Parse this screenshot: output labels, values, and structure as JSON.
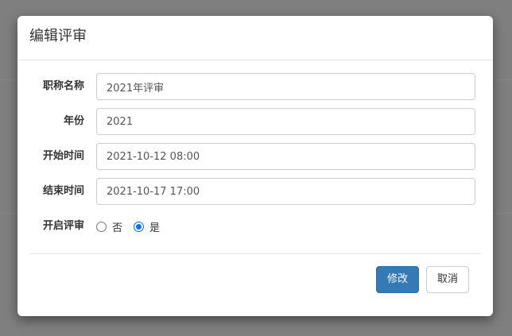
{
  "modal": {
    "title": "编辑评审",
    "fields": [
      {
        "label": "职称名称",
        "value": "2021年评审"
      },
      {
        "label": "年份",
        "value": "2021"
      },
      {
        "label": "开始时间",
        "value": "2021-10-12 08:00"
      },
      {
        "label": "结束时间",
        "value": "2021-10-17 17:00"
      }
    ],
    "radio": {
      "label": "开启评审",
      "options": [
        "否",
        "是"
      ],
      "selected": "是"
    },
    "buttons": {
      "submit": "修改",
      "cancel": "取消"
    }
  },
  "colors": {
    "primary": "#337ab7",
    "backdrop": "#7f7f7f",
    "radio_checked": "#0075ff"
  }
}
